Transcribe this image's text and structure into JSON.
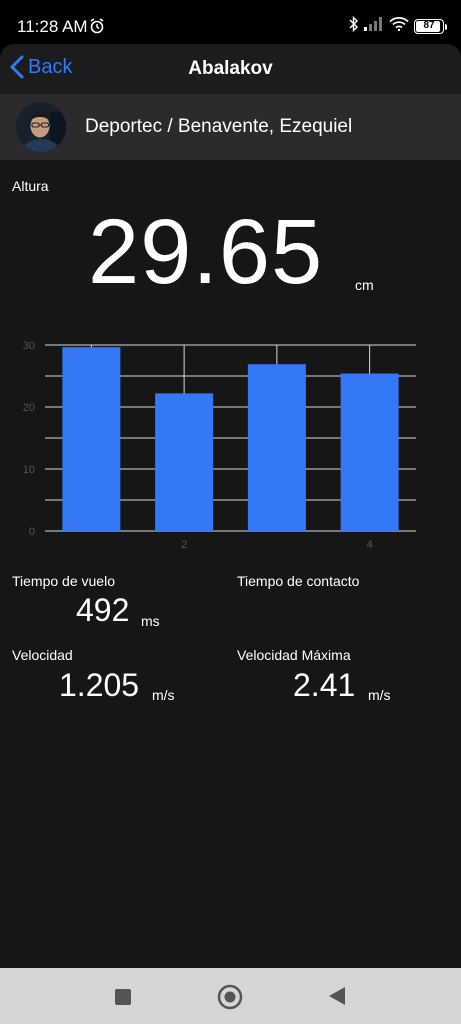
{
  "status": {
    "time": "11:28 AM",
    "battery": "87"
  },
  "nav": {
    "back_label": "Back",
    "title": "Abalakov"
  },
  "user": {
    "name": "Deportec / Benavente, Ezequiel"
  },
  "altura": {
    "label": "Altura",
    "value": "29.65",
    "unit": "cm"
  },
  "chart_data": {
    "type": "bar",
    "categories": [
      "1",
      "2",
      "3",
      "4"
    ],
    "x_tick_labels": [
      "",
      "2",
      "",
      "4"
    ],
    "values": [
      29.65,
      22.2,
      26.9,
      25.4
    ],
    "yticks": [
      0,
      10,
      20,
      30
    ],
    "ylim": [
      0,
      30
    ],
    "grid": true,
    "bar_color": "#3478f6",
    "title": "",
    "xlabel": "",
    "ylabel": ""
  },
  "metrics": {
    "tiempo_vuelo": {
      "label": "Tiempo de vuelo",
      "value": "492",
      "unit": "ms"
    },
    "tiempo_contacto": {
      "label": "Tiempo de contacto"
    },
    "velocidad": {
      "label": "Velocidad",
      "value": "1.205",
      "unit": "m/s"
    },
    "velocidad_maxima": {
      "label": "Velocidad Máxima",
      "value": "2.41",
      "unit": "m/s"
    }
  },
  "colors": {
    "accent": "#2e7cf6",
    "bar": "#3478f6",
    "background": "#161616"
  }
}
